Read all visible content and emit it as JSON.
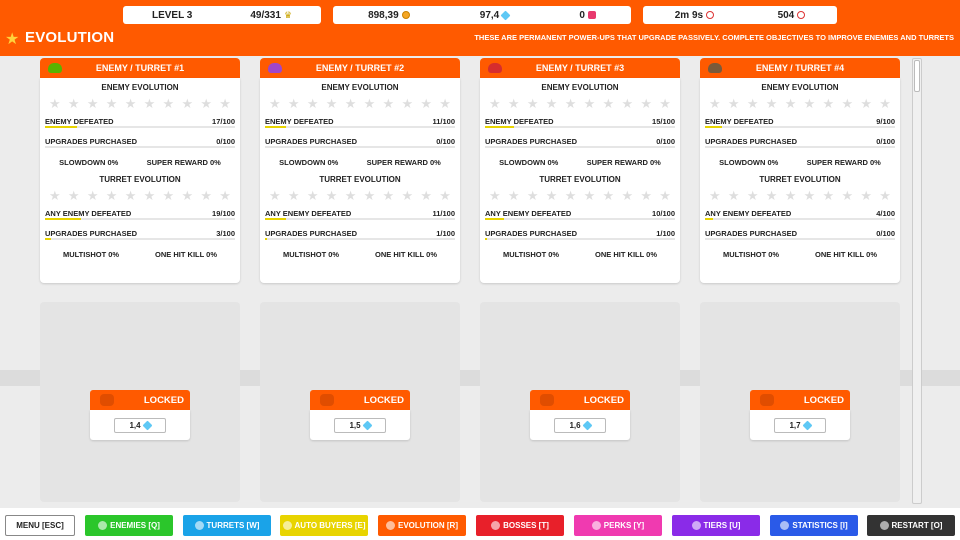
{
  "header": {
    "level": "LEVEL 3",
    "progress": "49/331",
    "coins": "898,39",
    "gems": "97,4",
    "pink": "0",
    "time": "2m 9s",
    "alerts": "504",
    "title": "EVOLUTION",
    "subtitle": "THESE ARE PERMANENT POWER-UPS THAT UPGRADE PASSIVELY. COMPLETE OBJECTIVES TO IMPROVE ENEMIES AND TURRETS"
  },
  "labels": {
    "enemy_evolution": "ENEMY EVOLUTION",
    "turret_evolution": "TURRET EVOLUTION",
    "enemy_defeated": "ENEMY DEFEATED",
    "upgrades_purchased": "UPGRADES PURCHASED",
    "any_enemy_defeated": "ANY ENEMY DEFEATED",
    "locked": "LOCKED"
  },
  "cards": [
    {
      "title": "ENEMY / TURRET #1",
      "icon_color": "#59b300",
      "enemy_defeated": "17/100",
      "enemy_frac": 0.17,
      "enemy_upgrades": "0/100",
      "enemy_up_frac": 0,
      "slowdown": "SLOWDOWN 0%",
      "super_reward": "SUPER REWARD 0%",
      "any_defeated": "19/100",
      "any_frac": 0.19,
      "turret_upgrades": "3/100",
      "turret_up_frac": 0.03,
      "multishot": "MULTISHOT 0%",
      "one_hit": "ONE HIT KILL 0%"
    },
    {
      "title": "ENEMY / TURRET #2",
      "icon_color": "#a046c8",
      "enemy_defeated": "11/100",
      "enemy_frac": 0.11,
      "enemy_upgrades": "0/100",
      "enemy_up_frac": 0,
      "slowdown": "SLOWDOWN 0%",
      "super_reward": "SUPER REWARD 0%",
      "any_defeated": "11/100",
      "any_frac": 0.11,
      "turret_upgrades": "1/100",
      "turret_up_frac": 0.01,
      "multishot": "MULTISHOT 0%",
      "one_hit": "ONE HIT KILL 0%"
    },
    {
      "title": "ENEMY / TURRET #3",
      "icon_color": "#d62d2d",
      "enemy_defeated": "15/100",
      "enemy_frac": 0.15,
      "enemy_upgrades": "0/100",
      "enemy_up_frac": 0,
      "slowdown": "SLOWDOWN 0%",
      "super_reward": "SUPER REWARD 0%",
      "any_defeated": "10/100",
      "any_frac": 0.1,
      "turret_upgrades": "1/100",
      "turret_up_frac": 0.01,
      "multishot": "MULTISHOT 0%",
      "one_hit": "ONE HIT KILL 0%"
    },
    {
      "title": "ENEMY / TURRET #4",
      "icon_color": "#7a5a3a",
      "enemy_defeated": "9/100",
      "enemy_frac": 0.09,
      "enemy_upgrades": "0/100",
      "enemy_up_frac": 0,
      "slowdown": "SLOWDOWN 0%",
      "super_reward": "SUPER REWARD 0%",
      "any_defeated": "4/100",
      "any_frac": 0.04,
      "turret_upgrades": "0/100",
      "turret_up_frac": 0,
      "multishot": "MULTISHOT 0%",
      "one_hit": "ONE HIT KILL 0%"
    }
  ],
  "locked": [
    {
      "cost": "1,4"
    },
    {
      "cost": "1,5"
    },
    {
      "cost": "1,6"
    },
    {
      "cost": "1,7"
    }
  ],
  "nav": [
    {
      "label": "MENU [ESC]",
      "color": "#ffffff",
      "text": "#222222",
      "icon": "none"
    },
    {
      "label": "ENEMIES [Q]",
      "color": "#2bc62b",
      "text": "#ffffff",
      "icon": "enemy-icon"
    },
    {
      "label": "TURRETS [W]",
      "color": "#1aa3e8",
      "text": "#ffffff",
      "icon": "turret-icon"
    },
    {
      "label": "AUTO BUYERS [E]",
      "color": "#e8d400",
      "text": "#ffffff",
      "icon": "autobuyer-icon"
    },
    {
      "label": "EVOLUTION [R]",
      "color": "#ff5a00",
      "text": "#ffffff",
      "icon": "star-icon"
    },
    {
      "label": "BOSSES [T]",
      "color": "#e8202a",
      "text": "#ffffff",
      "icon": "skull-icon"
    },
    {
      "label": "PERKS [Y]",
      "color": "#f03ab0",
      "text": "#ffffff",
      "icon": "perk-icon"
    },
    {
      "label": "TIERS [U]",
      "color": "#8a2be8",
      "text": "#ffffff",
      "icon": "tier-icon"
    },
    {
      "label": "STATISTICS [I]",
      "color": "#2a5ae8",
      "text": "#ffffff",
      "icon": "chart-icon"
    },
    {
      "label": "RESTART [O]",
      "color": "#333333",
      "text": "#ffffff",
      "icon": "restart-icon"
    }
  ],
  "colors": {
    "accent": "#ff5a00",
    "progress": "#e8d400"
  }
}
